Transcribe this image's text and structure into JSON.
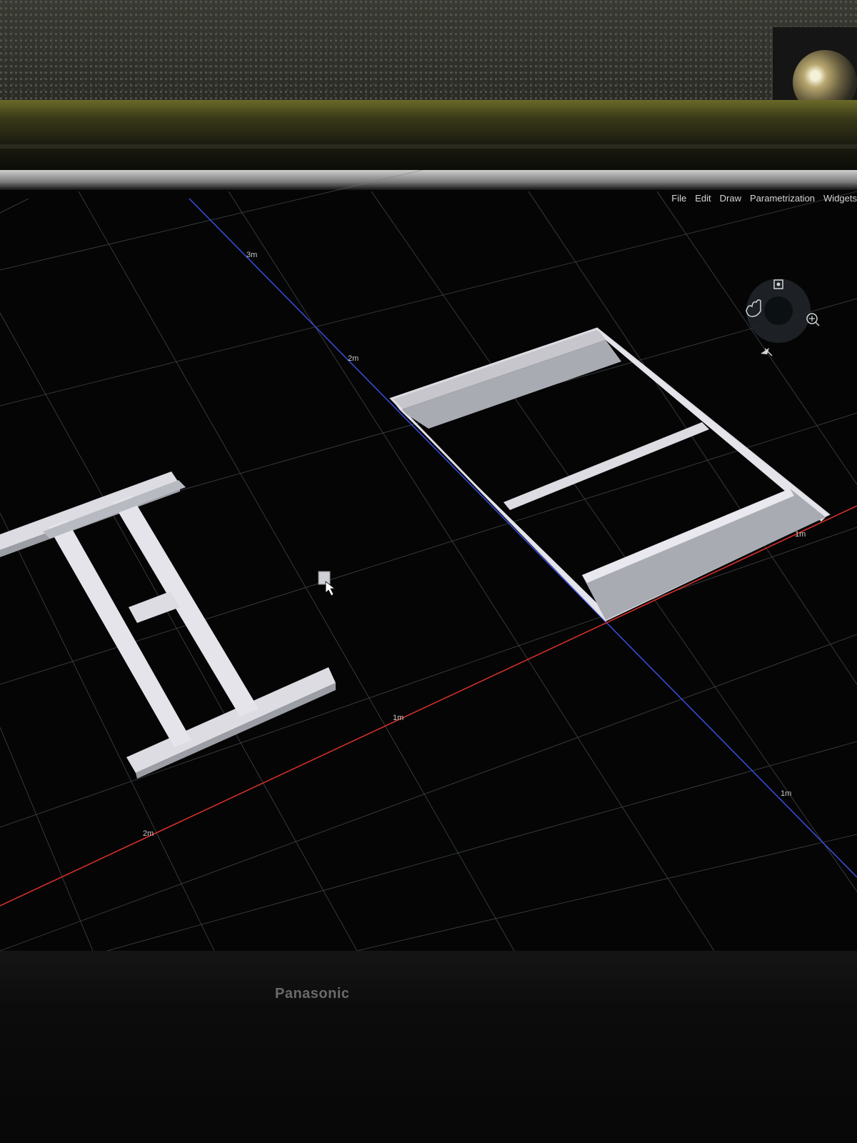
{
  "menubar": {
    "items": [
      {
        "label": "File"
      },
      {
        "label": "Edit"
      },
      {
        "label": "Draw"
      },
      {
        "label": "Parametrization"
      },
      {
        "label": "Widgets"
      }
    ]
  },
  "axes": {
    "blue_axis_labels": [
      "3m",
      "2m",
      "1m"
    ],
    "red_axis_labels": [
      "2m",
      "1m",
      "1m"
    ]
  },
  "colors": {
    "x_axis": "#e0322a",
    "z_axis": "#3a4fe0",
    "grid": "#7f8a8a",
    "frame": "#dcdce2"
  },
  "icons": {
    "navigation": [
      "fit-view-icon",
      "pan-hand-icon",
      "zoom-icon",
      "fly-icon"
    ],
    "cursor": "cursor-icon"
  },
  "monitor": {
    "brand": "Panasonic"
  }
}
